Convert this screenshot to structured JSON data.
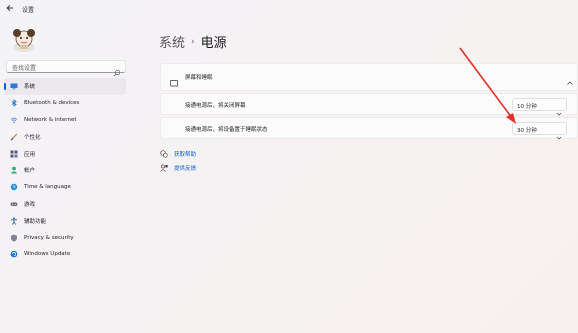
{
  "window": {
    "title": "设置",
    "back_icon": "back-arrow-icon"
  },
  "search": {
    "placeholder": "查找设置"
  },
  "sidebar": {
    "items": [
      {
        "label": "系统",
        "icon": "monitor-icon",
        "active": true
      },
      {
        "label": "Bluetooth & devices",
        "icon": "bluetooth-icon",
        "active": false
      },
      {
        "label": "Network & internet",
        "icon": "wifi-icon",
        "active": false
      },
      {
        "label": "个性化",
        "icon": "brush-icon",
        "active": false
      },
      {
        "label": "应用",
        "icon": "apps-icon",
        "active": false
      },
      {
        "label": "帐户",
        "icon": "person-icon",
        "active": false
      },
      {
        "label": "Time & language",
        "icon": "clock-globe-icon",
        "active": false
      },
      {
        "label": "游戏",
        "icon": "gamepad-icon",
        "active": false
      },
      {
        "label": "辅助功能",
        "icon": "accessibility-icon",
        "active": false
      },
      {
        "label": "Privacy & security",
        "icon": "shield-icon",
        "active": false
      },
      {
        "label": "Windows Update",
        "icon": "update-icon",
        "active": false
      }
    ]
  },
  "header": {
    "parent": "系统",
    "separator": "›",
    "current": "电源"
  },
  "screen_sleep": {
    "title": "屏幕和睡眠",
    "rows": [
      {
        "label": "接通电源后，将关闭屏幕",
        "value": "10 分钟"
      },
      {
        "label": "接通电源后，将设备置于睡眠状态",
        "value": "30 分钟"
      }
    ]
  },
  "links": {
    "help": "获取帮助",
    "feedback": "提供反馈"
  },
  "colors": {
    "accent": "#0a5fcf",
    "annotation_arrow": "#e0302a"
  }
}
